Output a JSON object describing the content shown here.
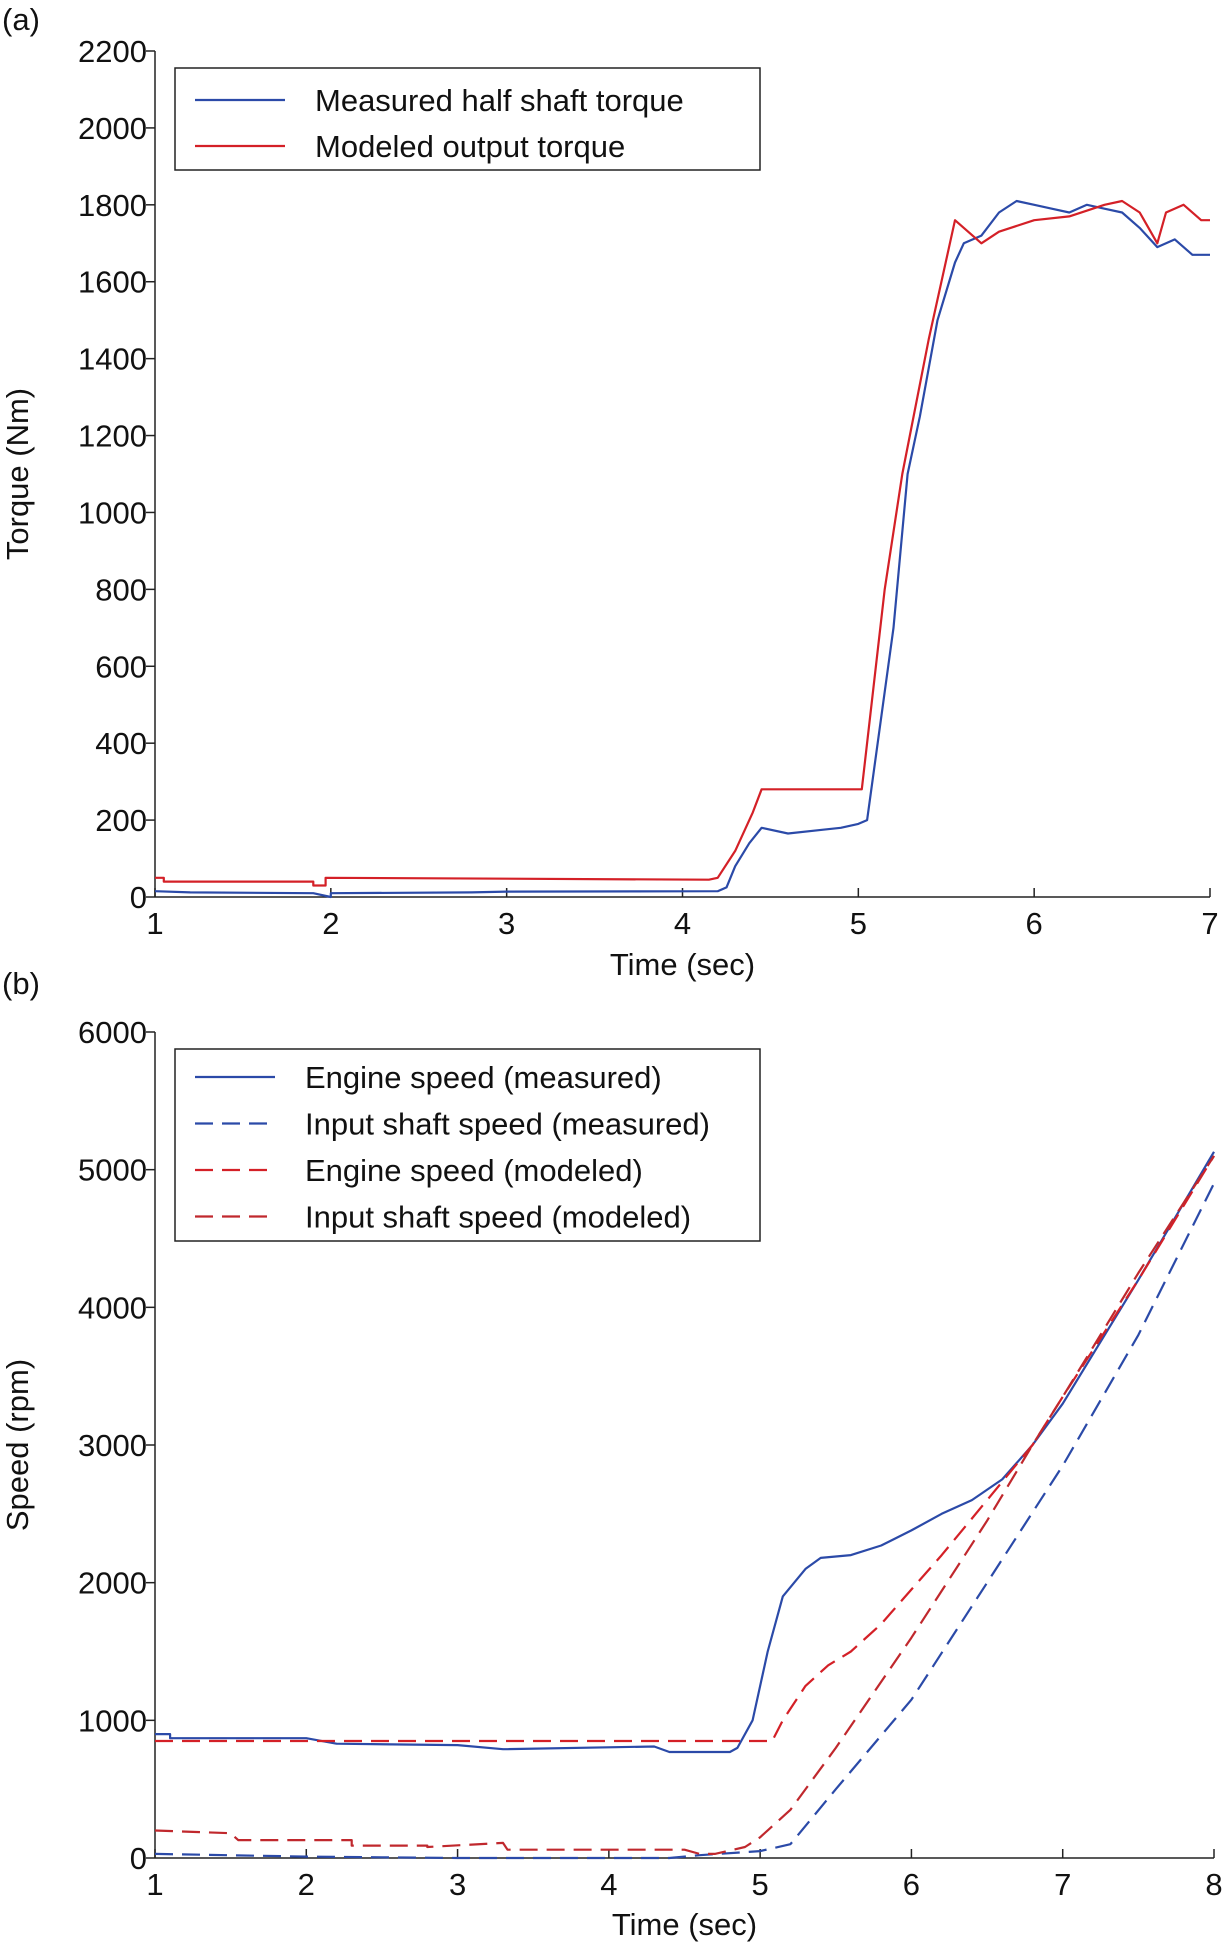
{
  "chart_data": [
    {
      "panel_label": "(a)",
      "type": "line",
      "xlabel": "Time (sec)",
      "ylabel": "Torque (Nm)",
      "xlim": [
        1,
        7
      ],
      "ylim": [
        0,
        2200
      ],
      "xticks": [
        1,
        2,
        3,
        4,
        5,
        6,
        7
      ],
      "yticks": [
        0,
        200,
        400,
        600,
        800,
        1000,
        1200,
        1400,
        1600,
        1800,
        2000,
        2200
      ],
      "grid": false,
      "legend_position": "top-left",
      "series": [
        {
          "name": "Measured half shaft torque",
          "color": "#2b4aa8",
          "dash": "solid",
          "x": [
            1.0,
            1.2,
            1.9,
            2.0,
            2.0,
            2.8,
            3.0,
            4.2,
            4.25,
            4.3,
            4.38,
            4.45,
            4.6,
            4.8,
            4.9,
            5.0,
            5.05,
            5.2,
            5.28,
            5.35,
            5.45,
            5.55,
            5.6,
            5.7,
            5.8,
            5.9,
            6.0,
            6.1,
            6.2,
            6.3,
            6.4,
            6.5,
            6.6,
            6.7,
            6.8,
            6.9,
            7.0
          ],
          "y": [
            15,
            12,
            10,
            0,
            10,
            12,
            14,
            15,
            25,
            80,
            140,
            180,
            165,
            175,
            180,
            190,
            200,
            700,
            1100,
            1250,
            1500,
            1650,
            1700,
            1720,
            1780,
            1810,
            1800,
            1790,
            1780,
            1800,
            1790,
            1780,
            1740,
            1690,
            1710,
            1670,
            1670
          ]
        },
        {
          "name": "Modeled output torque",
          "color": "#d42027",
          "dash": "solid",
          "x": [
            1.0,
            1.05,
            1.05,
            1.9,
            1.9,
            1.97,
            1.97,
            4.15,
            4.2,
            4.3,
            4.4,
            4.45,
            5.02,
            5.15,
            5.25,
            5.4,
            5.55,
            5.7,
            5.8,
            6.0,
            6.2,
            6.4,
            6.5,
            6.6,
            6.7,
            6.75,
            6.85,
            6.95,
            7.0
          ],
          "y": [
            50,
            50,
            40,
            40,
            30,
            30,
            50,
            45,
            50,
            120,
            220,
            280,
            280,
            800,
            1100,
            1450,
            1760,
            1700,
            1730,
            1760,
            1770,
            1800,
            1810,
            1780,
            1700,
            1780,
            1800,
            1760,
            1760
          ]
        }
      ]
    },
    {
      "panel_label": "(b)",
      "type": "line",
      "xlabel": "Time (sec)",
      "ylabel": "Speed (rpm)",
      "xlim": [
        1,
        8
      ],
      "ylim": [
        0,
        6000
      ],
      "xticks": [
        1,
        2,
        3,
        4,
        5,
        6,
        7,
        8
      ],
      "yticks": [
        0,
        1000,
        2000,
        3000,
        4000,
        5000,
        6000
      ],
      "grid": false,
      "legend_position": "top-left",
      "series": [
        {
          "name": "Engine speed (measured)",
          "color": "#2b4aa8",
          "dash": "solid",
          "x": [
            1.0,
            1.1,
            1.1,
            2.0,
            2.2,
            3.0,
            3.3,
            4.3,
            4.4,
            4.8,
            4.85,
            4.95,
            5.05,
            5.15,
            5.3,
            5.4,
            5.6,
            5.8,
            6.0,
            6.2,
            6.4,
            6.6,
            6.8,
            7.0,
            7.5,
            8.0
          ],
          "y": [
            900,
            900,
            870,
            870,
            830,
            820,
            790,
            810,
            770,
            770,
            800,
            1000,
            1500,
            1900,
            2100,
            2180,
            2200,
            2270,
            2380,
            2500,
            2600,
            2750,
            3000,
            3300,
            4200,
            5130
          ]
        },
        {
          "name": "Input shaft speed (measured)",
          "color": "#2b4aa8",
          "dash": "dashed",
          "x": [
            1.0,
            2.0,
            3.0,
            4.4,
            4.6,
            5.0,
            5.2,
            5.5,
            6.0,
            6.5,
            7.0,
            7.5,
            8.0
          ],
          "y": [
            30,
            10,
            0,
            0,
            20,
            50,
            100,
            500,
            1150,
            2000,
            2850,
            3800,
            4900
          ]
        },
        {
          "name": "Engine speed (modeled)",
          "color": "#d42027",
          "dash": "dashed",
          "x": [
            1.0,
            5.08,
            5.15,
            5.3,
            5.45,
            5.6,
            5.8,
            6.0,
            6.2,
            6.5,
            6.8,
            7.0,
            7.5,
            8.0
          ],
          "y": [
            850,
            850,
            1000,
            1250,
            1400,
            1500,
            1700,
            1950,
            2200,
            2600,
            3000,
            3350,
            4200,
            5100
          ]
        },
        {
          "name": "Input shaft speed (modeled)",
          "color": "#c0282d",
          "dash": "dashed",
          "x": [
            1.0,
            1.5,
            1.55,
            2.3,
            2.3,
            2.8,
            2.8,
            3.3,
            3.33,
            4.5,
            4.6,
            4.7,
            4.9,
            5.0,
            5.2,
            5.5,
            6.0,
            6.5,
            6.8,
            7.0,
            7.5,
            8.0
          ],
          "y": [
            200,
            180,
            130,
            130,
            90,
            90,
            80,
            110,
            60,
            60,
            30,
            30,
            80,
            150,
            350,
            800,
            1600,
            2450,
            3000,
            3350,
            4250,
            5100
          ]
        }
      ]
    }
  ]
}
